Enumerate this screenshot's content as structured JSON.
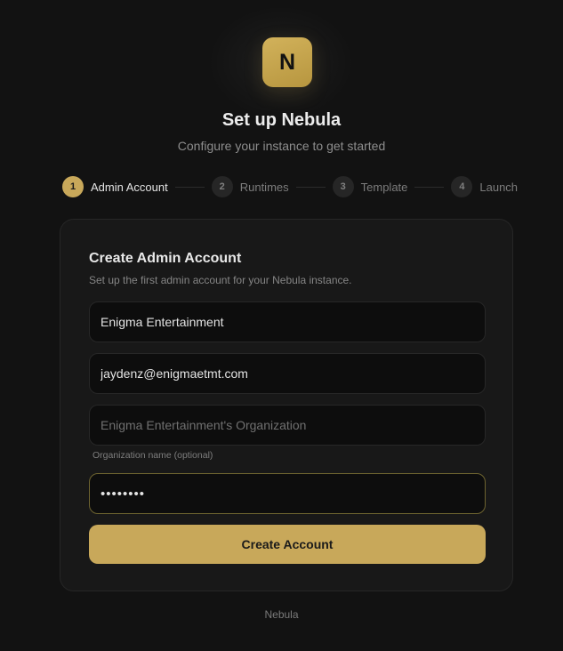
{
  "header": {
    "logo_letter": "N",
    "title": "Set up Nebula",
    "subtitle": "Configure your instance to get started"
  },
  "steps": [
    {
      "number": "1",
      "label": "Admin Account",
      "active": true
    },
    {
      "number": "2",
      "label": "Runtimes",
      "active": false
    },
    {
      "number": "3",
      "label": "Template",
      "active": false
    },
    {
      "number": "4",
      "label": "Launch",
      "active": false
    }
  ],
  "form": {
    "title": "Create Admin Account",
    "description": "Set up the first admin account for your Nebula instance.",
    "name_value": "Enigma Entertainment",
    "email_value": "jaydenz@enigmaetmt.com",
    "org_placeholder": "Enigma Entertainment's Organization",
    "org_hint": "Organization name (optional)",
    "password_value": "••••••••",
    "submit_label": "Create Account"
  },
  "footer": {
    "text": "Nebula"
  },
  "colors": {
    "accent": "#c8a85a",
    "background": "#121212",
    "card": "#181818"
  }
}
